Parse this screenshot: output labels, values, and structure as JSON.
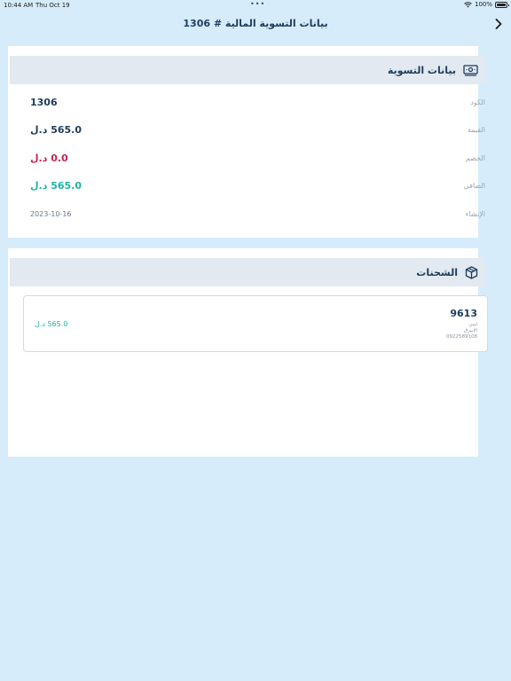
{
  "status_bar": {
    "time": "10:44 AM",
    "date": "Thu Oct 19",
    "dots": "•••",
    "battery": "100%"
  },
  "nav": {
    "title": "بيانات التسوية المالية # 1306",
    "back_icon": "chevron-right-icon"
  },
  "settlement": {
    "title": "بيانات التسوية",
    "icon": "money-icon",
    "rows": [
      {
        "label": "الكود",
        "value": "1306",
        "color": "#1d3b5c"
      },
      {
        "label": "القيمة",
        "value": "565.0 د.ل",
        "color": "#1d3b5c"
      },
      {
        "label": "الخصم",
        "value": "0.0 د.ل",
        "color": "#c1264e"
      },
      {
        "label": "الصافي",
        "value": "565.0 د.ل",
        "color": "#1fb3a3"
      },
      {
        "label": "الإنشاء",
        "value": "2023-10-16",
        "color": "#6b7785"
      }
    ]
  },
  "shipments": {
    "title": "الشحنات",
    "icon": "box-icon",
    "items": [
      {
        "number": "9613",
        "line1": "ليبي",
        "line2": "الابيرق",
        "phone": "0922589108",
        "amount": "565.0 د.ل"
      }
    ]
  },
  "colors": {
    "background": "#d6ecfa",
    "header_bg": "#e2e9f1",
    "primary": "#1d3b5c",
    "accent": "#1fb3a3",
    "danger": "#c1264e"
  }
}
